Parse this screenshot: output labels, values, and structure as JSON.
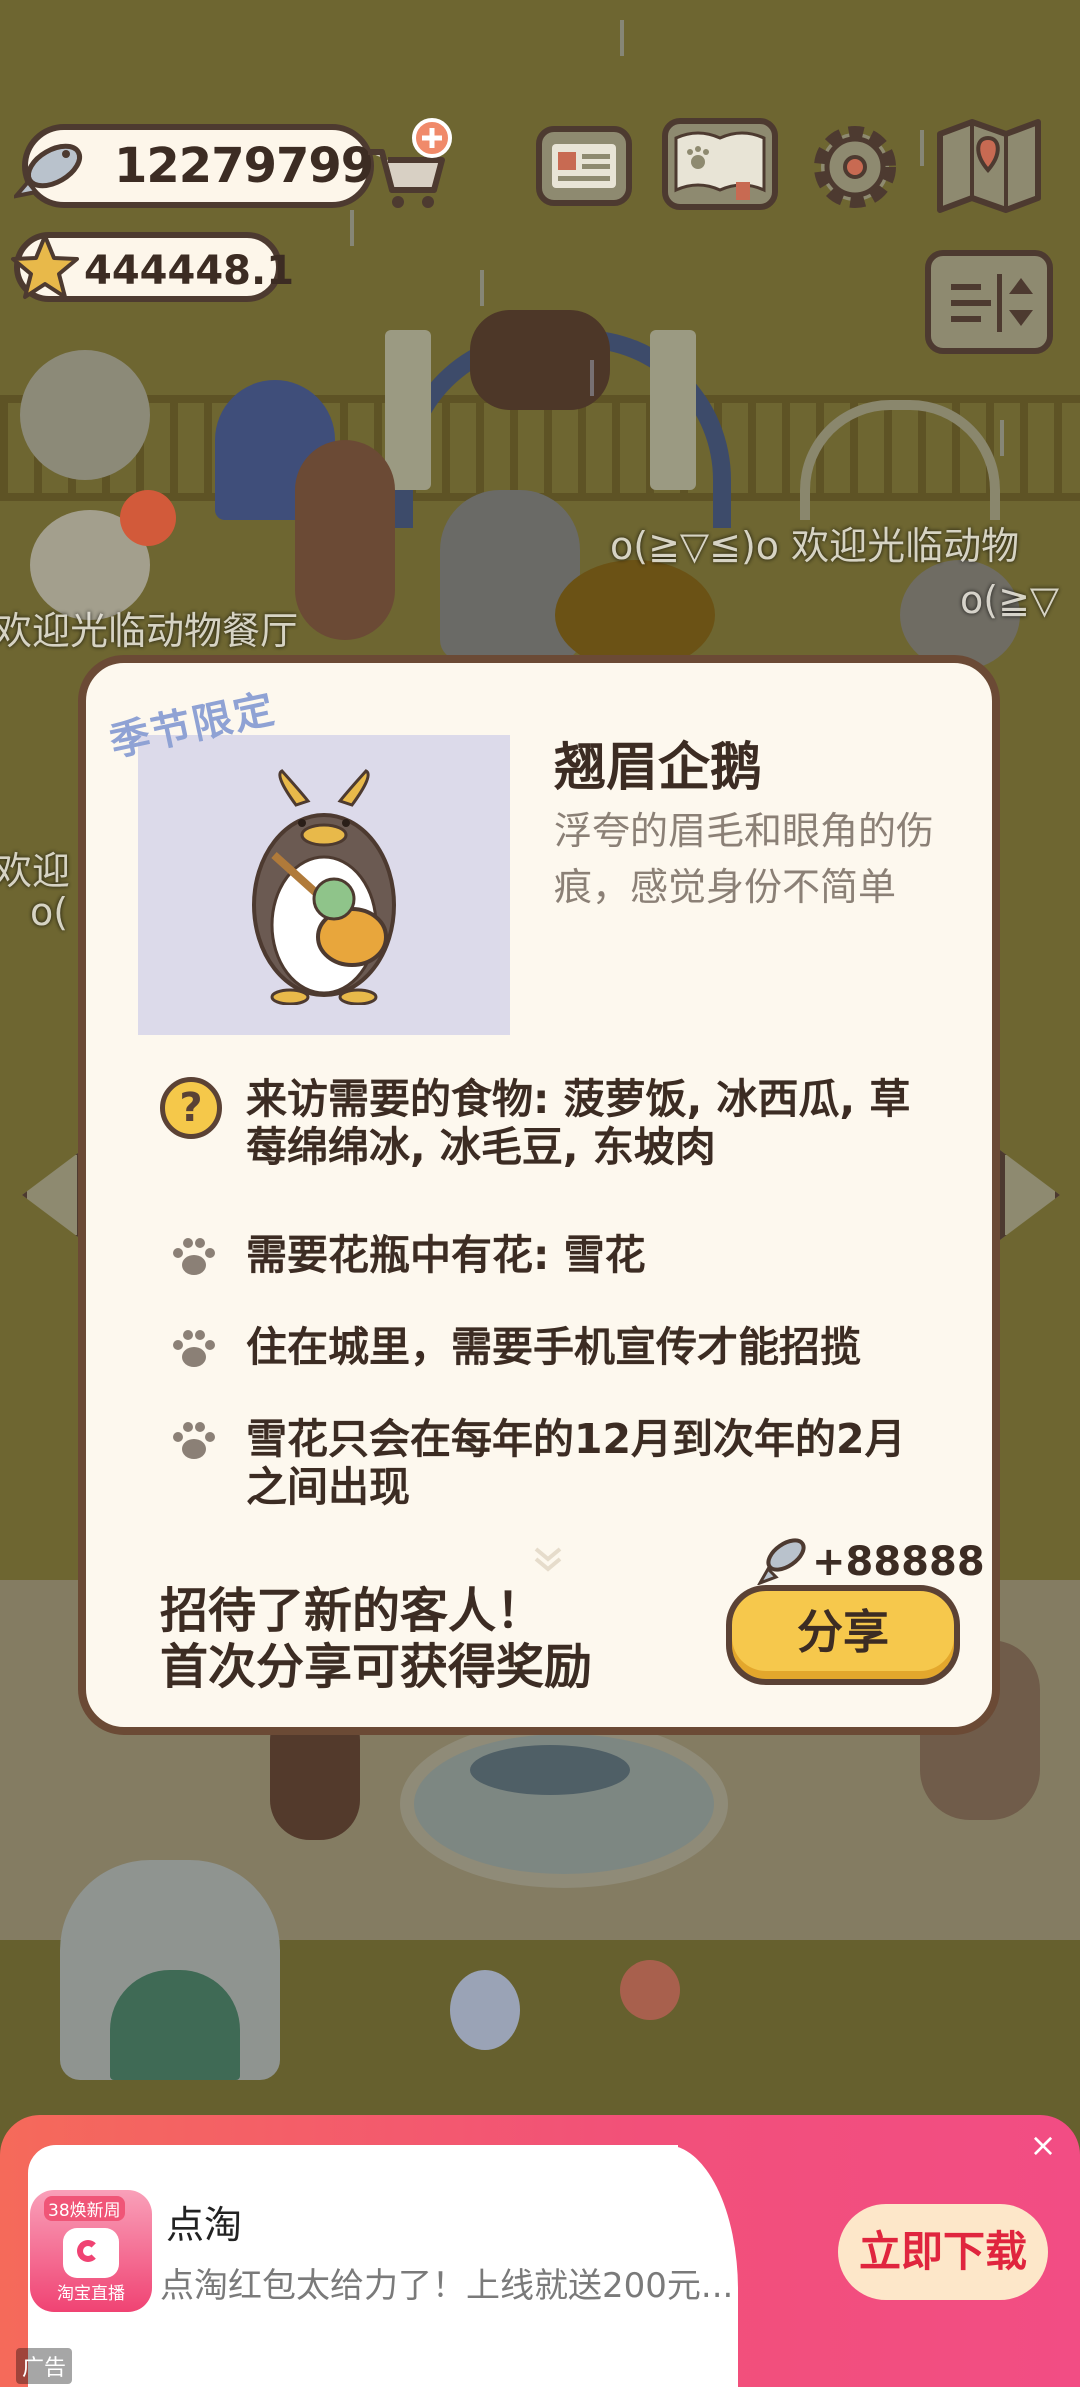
{
  "hud": {
    "fish_count": "12279799",
    "star_count": "444448.1",
    "icons": [
      "fish-icon",
      "cart-add-icon",
      "star-icon",
      "newspaper-icon",
      "paw-book-icon",
      "gear-icon",
      "map-icon",
      "sort-icon"
    ]
  },
  "scrolling_messages": [
    "o(≧▽≦)o 欢迎光临动物",
    "o(≧▽",
    "欢迎光临动物餐厅",
    "欢迎",
    "o("
  ],
  "visitor_card": {
    "tag": "季节限定",
    "name": "翘眉企鹅",
    "description": "浮夸的眉毛和眼角的伤痕，感觉身份不简单",
    "requirements": [
      {
        "icon": "question-icon",
        "text": "来访需要的食物: 菠萝饭, 冰西瓜, 草莓绵绵冰, 冰毛豆, 东坡肉"
      },
      {
        "icon": "paw-icon",
        "text": "需要花瓶中有花: 雪花"
      },
      {
        "icon": "paw-icon",
        "text": "住在城里，需要手机宣传才能招揽"
      },
      {
        "icon": "paw-icon",
        "text": "雪花只会在每年的12月到次年的2月之间出现"
      }
    ],
    "reward": "+88888",
    "invite_line1": "招待了新的客人！",
    "invite_line2": "首次分享可获得奖励",
    "share_label": "分享"
  },
  "ad": {
    "badge": "38焕新周",
    "logo_caption": "淘宝直播",
    "title": "点淘",
    "description": "点淘红包太给力了！上线就送200元...",
    "cta": "立即下载",
    "close": "×",
    "label": "广告"
  },
  "colors": {
    "modal_bg": "#fdf8ee",
    "modal_border": "#6b4a35",
    "share_button": "#f6c84c",
    "tag_blue": "#8fa2d4",
    "ad_gradient_start": "#f56a5a",
    "ad_gradient_end": "#f24d84"
  }
}
